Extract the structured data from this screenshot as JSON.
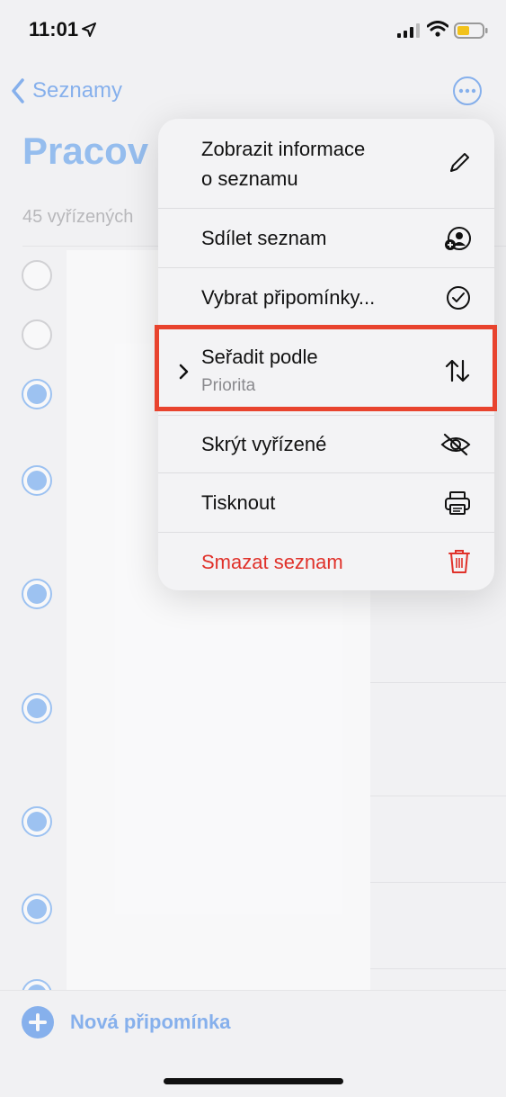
{
  "status_bar": {
    "time": "11:01"
  },
  "nav": {
    "back_label": "Seznamy"
  },
  "list": {
    "title": "Pracov",
    "done_count": "45 vyřízených"
  },
  "menu": {
    "items": [
      {
        "label": "Zobrazit informace\no seznamu",
        "icon": "pencil-icon"
      },
      {
        "label": "Sdílet seznam",
        "icon": "share-person-icon"
      },
      {
        "label": "Vybrat připomínky...",
        "icon": "checkmark-circle-icon"
      },
      {
        "label": "Seřadit podle",
        "sublabel": "Priorita",
        "icon": "sort-arrows-icon",
        "has_submenu": true,
        "highlighted": true
      },
      {
        "label": "Skrýt vyřízené",
        "icon": "eye-slash-icon"
      },
      {
        "label": "Tisknout",
        "icon": "printer-icon"
      },
      {
        "label": "Smazat seznam",
        "icon": "trash-icon",
        "destructive": true
      }
    ]
  },
  "bottom": {
    "add_label": "Nová připomínka"
  },
  "colors": {
    "accent": "#2f7be8",
    "destructive": "#e0312a",
    "highlight_box": "#e8432e"
  }
}
